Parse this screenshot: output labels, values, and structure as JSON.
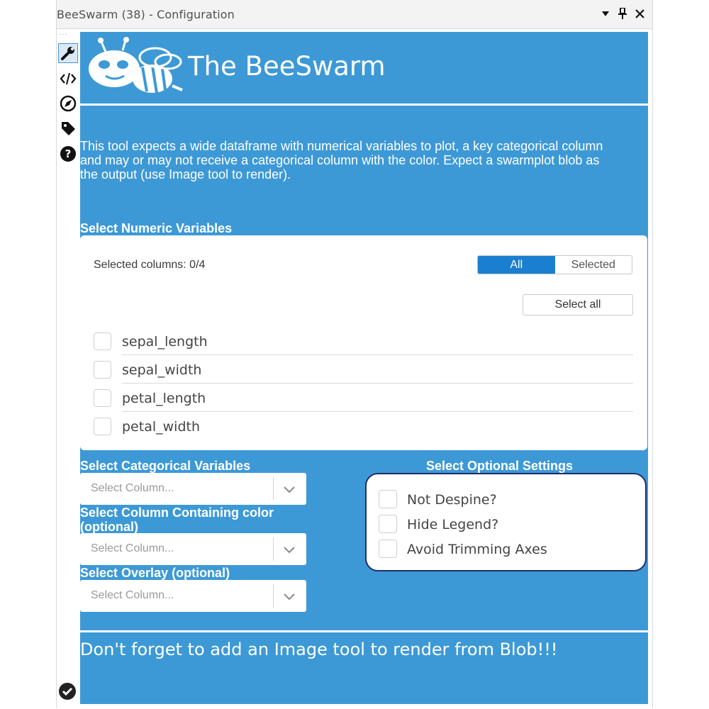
{
  "window": {
    "title": "BeeSwarm (38) - Configuration",
    "controls": [
      "dropdown-arrow-icon",
      "pin-icon",
      "close-icon"
    ]
  },
  "toolbar": {
    "grip": "···",
    "items": [
      "wrench-icon",
      "code-icon",
      "compass-icon",
      "tag-icon",
      "help-icon"
    ],
    "status_icon": "checkmark-circle-icon"
  },
  "header": {
    "title": "The BeeSwarm",
    "logo": "bee-logo-icon"
  },
  "description": "This tool expects a wide dataframe with numerical variables to plot, a key categorical column and may or may not receive a categorical column with the color. Expect a swarmplot blob as the output (use Image tool to render).",
  "numeric": {
    "label": "Select Numeric Variables",
    "selected_count": "Selected columns: 0/4",
    "filter_options": [
      "All",
      "Selected"
    ],
    "active_filter": "All",
    "select_all_label": "Select all",
    "columns": [
      "sepal_length",
      "sepal_width",
      "petal_length",
      "petal_width"
    ]
  },
  "categorical": {
    "label": "Select Categorical Variables",
    "placeholder": "Select Column..."
  },
  "color_column": {
    "label": "Select Column Containing color (optional)",
    "placeholder": "Select Column..."
  },
  "overlay": {
    "label": "Select Overlay (optional)",
    "placeholder": "Select Column..."
  },
  "optional_settings": {
    "label": "Select Optional Settings",
    "options": [
      "Not Despine?",
      "Hide Legend?",
      "Avoid Trimming Axes"
    ]
  },
  "footer_note": "Don't forget to add an Image tool to render from Blob!!!",
  "colors": {
    "panel_blue": "#3d99d6",
    "toggle_active": "#1a7fd0",
    "settings_border": "#1e2a6e"
  }
}
